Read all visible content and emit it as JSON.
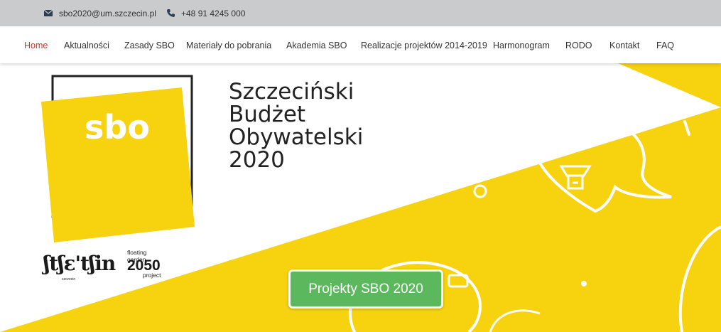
{
  "topbar": {
    "email": "sbo2020@um.szczecin.pl",
    "phone": "+48 91 4245 000",
    "email_icon": "envelope-icon",
    "phone_icon": "phone-icon"
  },
  "nav": {
    "items": [
      {
        "label": "Home",
        "active": true
      },
      {
        "label": "Aktualności",
        "active": false
      },
      {
        "label": "Zasady SBO",
        "active": false
      },
      {
        "label": "Materiały do pobrania",
        "active": false
      },
      {
        "label": "Akademia SBO",
        "active": false
      },
      {
        "label": "Realizacje projektów 2014-2019",
        "active": false
      },
      {
        "label": "Harmonogram",
        "active": false
      },
      {
        "label": "RODO",
        "active": false
      },
      {
        "label": "Kontakt",
        "active": false
      },
      {
        "label": "FAQ",
        "active": false
      }
    ]
  },
  "hero": {
    "logo_text": "sbo",
    "title": "Szczeciński\nBudżet\nObywatelski\n2020",
    "cta_label": "Projekty SBO 2020"
  },
  "partner_logo": {
    "word": "ʃtʃɛ'tʃin",
    "year": "2050",
    "line1": "floating garden",
    "line2": "project",
    "line3": "szczecin"
  },
  "colors": {
    "topbar": "#c9cbcd",
    "nav_active": "#e52a2a",
    "brand_yellow": "#f6d20f",
    "cta_green": "#5cb85c"
  }
}
